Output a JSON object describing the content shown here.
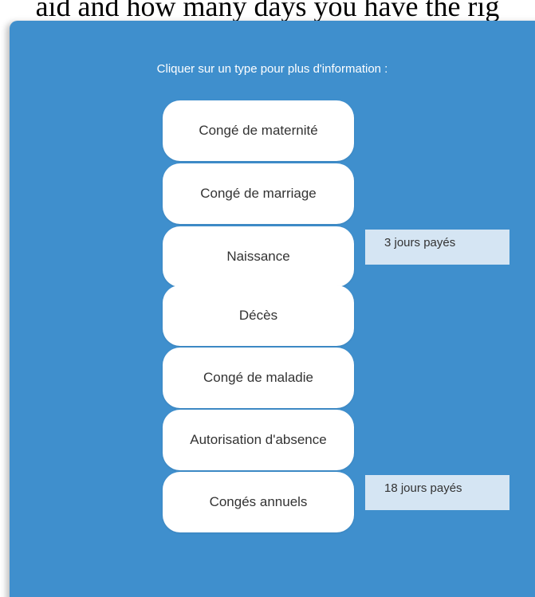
{
  "top_caption": "aid and how many days you have the rig",
  "instruction": "Cliquer sur un type pour plus d'information :",
  "types": [
    {
      "label": "Congé de maternité"
    },
    {
      "label": "Congé de marriage"
    },
    {
      "label": "Naissance",
      "info": "3 jours payés"
    },
    {
      "label": "Décès"
    },
    {
      "label": "Congé de maladie"
    },
    {
      "label": "Autorisation d'absence"
    },
    {
      "label": "Congés annuels",
      "info": "18 jours payés"
    }
  ],
  "colors": {
    "panel_background": "#3f8fcd",
    "button_background": "#ffffff",
    "info_background": "#d5e5f3",
    "text": "#333333"
  }
}
